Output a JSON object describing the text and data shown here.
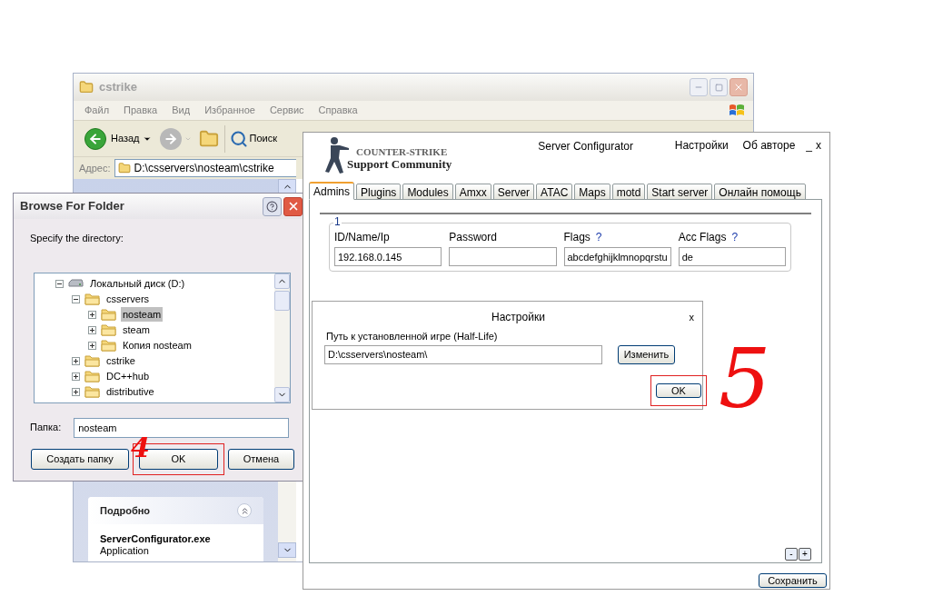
{
  "explorer": {
    "title": "cstrike",
    "menu": [
      "Файл",
      "Правка",
      "Вид",
      "Избранное",
      "Сервис",
      "Справка"
    ],
    "back_label": "Назад",
    "search_label": "Поиск",
    "address_label": "Адрес:",
    "address": "D:\\csservers\\nosteam\\cstrike",
    "details": {
      "title": "Подробно",
      "file_name": "ServerConfigurator.exe",
      "file_type": "Application"
    }
  },
  "browse_dialog": {
    "title": "Browse For Folder",
    "prompt": "Specify the directory:",
    "tree": [
      {
        "kind": "drive",
        "label": "Локальный диск (D:)",
        "expanded": true,
        "selected": false,
        "children": [
          {
            "kind": "folder",
            "label": "csservers",
            "expanded": true,
            "selected": false,
            "children": [
              {
                "kind": "folder",
                "label": "nosteam",
                "expanded": false,
                "selected": true
              },
              {
                "kind": "folder",
                "label": "steam",
                "expanded": false,
                "selected": false
              },
              {
                "kind": "folder",
                "label": "Копия nosteam",
                "expanded": false,
                "selected": false
              }
            ]
          },
          {
            "kind": "folder",
            "label": "cstrike",
            "expanded": false,
            "selected": false
          },
          {
            "kind": "folder",
            "label": "DC++hub",
            "expanded": false,
            "selected": false
          },
          {
            "kind": "folder",
            "label": "distributive",
            "expanded": false,
            "selected": false
          }
        ]
      }
    ],
    "folder_label": "Папка:",
    "folder": "nosteam",
    "buttons": [
      {
        "label": "Создать папку",
        "highlighted": false
      },
      {
        "label": "OK",
        "highlighted": true
      },
      {
        "label": "Отмена",
        "highlighted": false
      }
    ],
    "annotation": "4"
  },
  "configurator": {
    "logo_top": "COUNTER-STRIKE",
    "logo_bottom": "Support Community",
    "title": "Server Configurator",
    "menu": [
      "Настройки",
      "Об авторе"
    ],
    "minimize": "_",
    "close": "x",
    "tabs": [
      {
        "label": "Admins",
        "selected": true
      },
      {
        "label": "Plugins",
        "selected": false
      },
      {
        "label": "Modules",
        "selected": false
      },
      {
        "label": "Amxx",
        "selected": false
      },
      {
        "label": "Server",
        "selected": false
      },
      {
        "label": "ATAC",
        "selected": false
      },
      {
        "label": "Maps",
        "selected": false
      },
      {
        "label": "motd",
        "selected": false
      },
      {
        "label": "Start server",
        "selected": false
      },
      {
        "label": "Онлайн помощь",
        "selected": false
      }
    ],
    "admin": {
      "number": "1",
      "fields": [
        {
          "label": "ID/Name/Ip",
          "value": "192.168.0.145"
        },
        {
          "label": "Password"
        },
        {
          "label": "Flags",
          "help": "?",
          "value": "abcdefghijklmnopqrstu"
        },
        {
          "label": "Acc Flags",
          "help": "?",
          "value": "de"
        }
      ]
    },
    "remove_button": "-",
    "add_button": "+",
    "save_button": "Сохранить"
  },
  "settings_dialog": {
    "title": "Настройки",
    "close": "x",
    "path_label": "Путь к установленной игре (Half-Life)",
    "path": "D:\\csservers\\nosteam\\",
    "change_button": "Изменить",
    "ok_button": {
      "label": "OK",
      "highlighted": true
    },
    "annotation": "5"
  }
}
